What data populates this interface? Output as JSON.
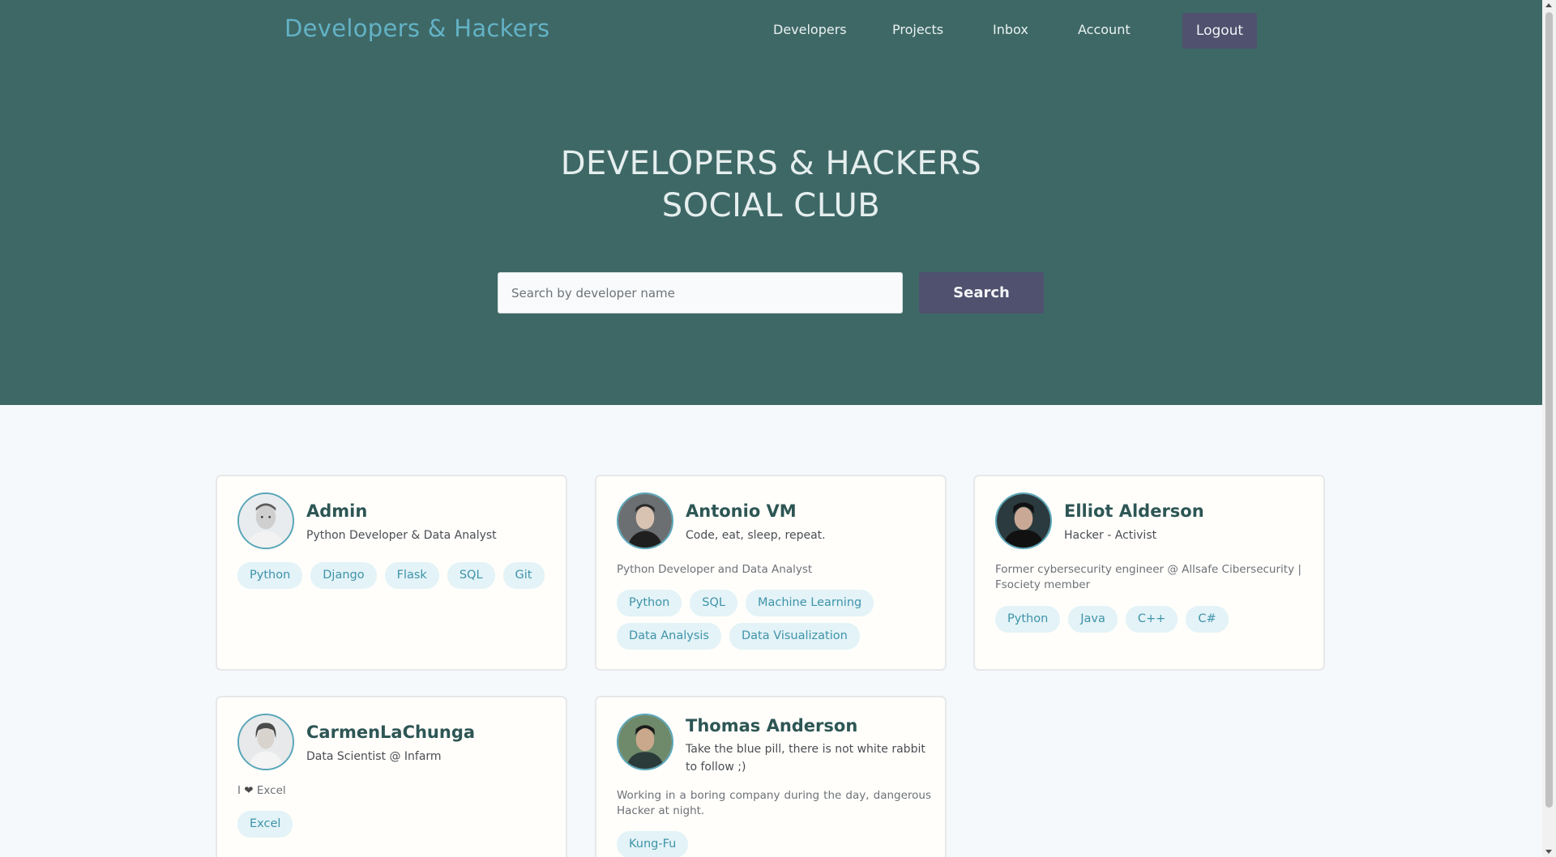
{
  "nav": {
    "brand": "Developers & Hackers",
    "links": [
      "Developers",
      "Projects",
      "Inbox",
      "Account"
    ],
    "logout": "Logout"
  },
  "hero": {
    "title_line1": "DEVELOPERS & HACKERS",
    "title_line2": "SOCIAL CLUB",
    "search_placeholder": "Search by developer name",
    "search_button": "Search"
  },
  "developers": [
    {
      "name": "Admin",
      "tagline": "Python Developer & Data Analyst",
      "bio": "",
      "skills": [
        "Python",
        "Django",
        "Flask",
        "SQL",
        "Git"
      ]
    },
    {
      "name": "Antonio VM",
      "tagline": "Code, eat, sleep, repeat.",
      "bio": "Python Developer and Data Analyst",
      "skills": [
        "Python",
        "SQL",
        "Machine Learning",
        "Data Analysis",
        "Data Visualization"
      ]
    },
    {
      "name": "Elliot Alderson",
      "tagline": "Hacker - Activist",
      "bio": "Former cybersecurity engineer @ Allsafe Cibersecurity | Fsociety member",
      "skills": [
        "Python",
        "Java",
        "C++",
        "C#"
      ]
    },
    {
      "name": "CarmenLaChunga",
      "tagline": "Data Scientist @ Infarm",
      "bio_prefix": "I",
      "bio_suffix": "Excel",
      "skills": [
        "Excel"
      ]
    },
    {
      "name": "Thomas Anderson",
      "tagline": "Take the blue pill, there is not white rabbit to follow ;)",
      "bio": "Working in a boring company during the day, dangerous Hacker at night.",
      "skills": [
        "Kung-Fu"
      ]
    }
  ],
  "colors": {
    "hero_bg": "#3e6866",
    "brand": "#63b2c6",
    "button_bg": "#4f516e",
    "tag_bg": "#e3f3f7",
    "tag_text": "#3f93a9",
    "name_text": "#2d5654"
  }
}
